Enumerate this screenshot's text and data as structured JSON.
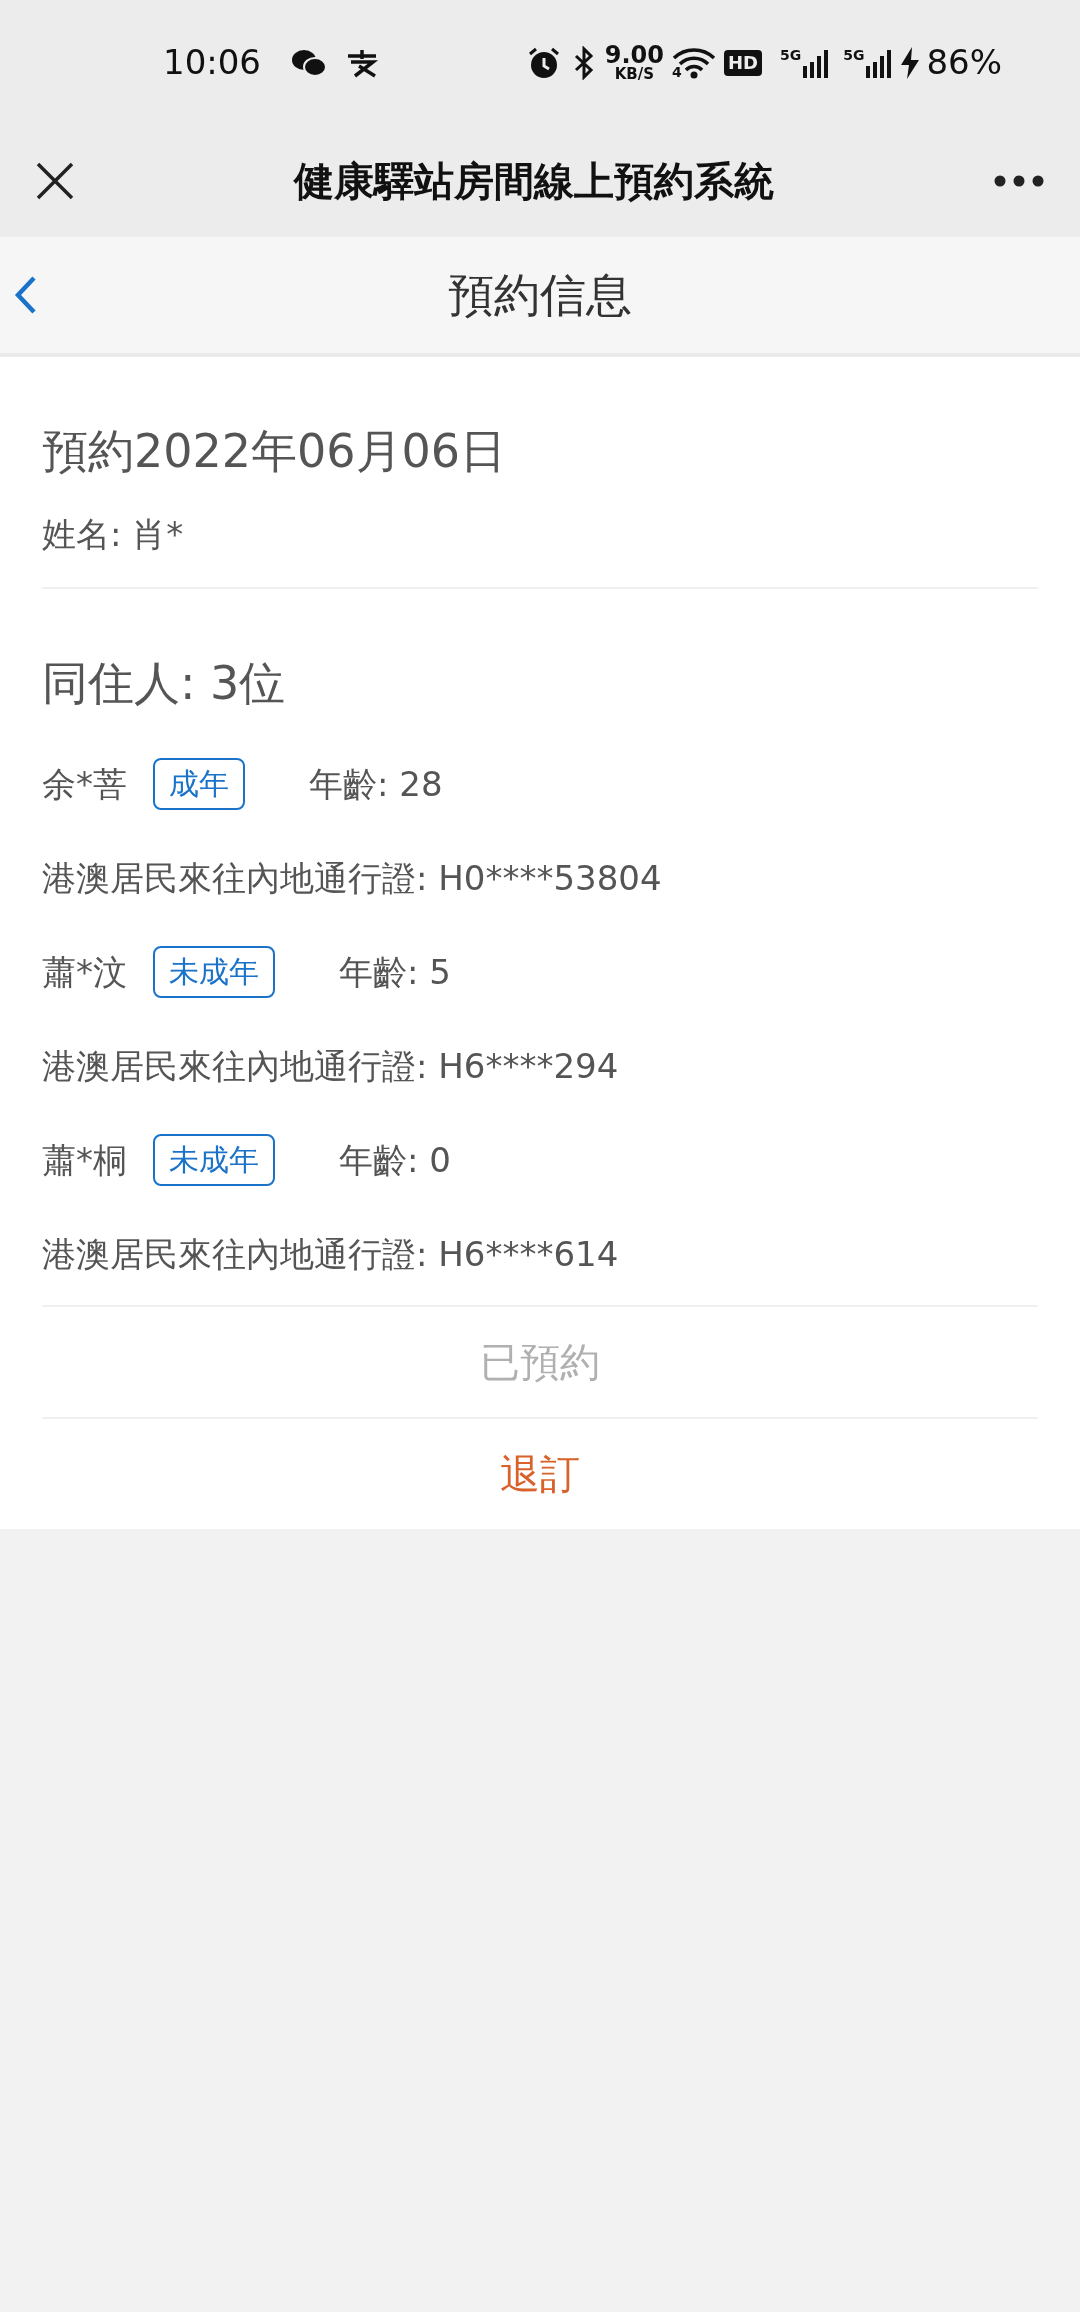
{
  "status_bar": {
    "time": "10:06",
    "speed_value": "9.00",
    "speed_unit": "KB/S",
    "wifi_label": "4",
    "hd_label": "HD",
    "network_1": "5G",
    "network_2": "5G",
    "battery": "86%"
  },
  "title_bar": {
    "title": "健康驛站房間線上預約系統"
  },
  "header": {
    "title": "預約信息"
  },
  "booking": {
    "date_heading": "預約2022年06月06日",
    "name_line": "姓名: 肖*"
  },
  "companions": {
    "heading": "同住人: 3位",
    "items": [
      {
        "name": "余*菩",
        "tag": "成年",
        "age": "年齡: 28",
        "document": "港澳居民來往內地通行證: H0****53804"
      },
      {
        "name": "蕭*汶",
        "tag": "未成年",
        "age": "年齡: 5",
        "document": "港澳居民來往內地通行證: H6****294"
      },
      {
        "name": "蕭*桐",
        "tag": "未成年",
        "age": "年齡: 0",
        "document": "港澳居民來往內地通行證: H6****614"
      }
    ]
  },
  "actions": [
    {
      "label": "已預約",
      "kind": "status",
      "disabled": true
    },
    {
      "label": "退訂",
      "kind": "cancel",
      "disabled": false
    }
  ]
}
